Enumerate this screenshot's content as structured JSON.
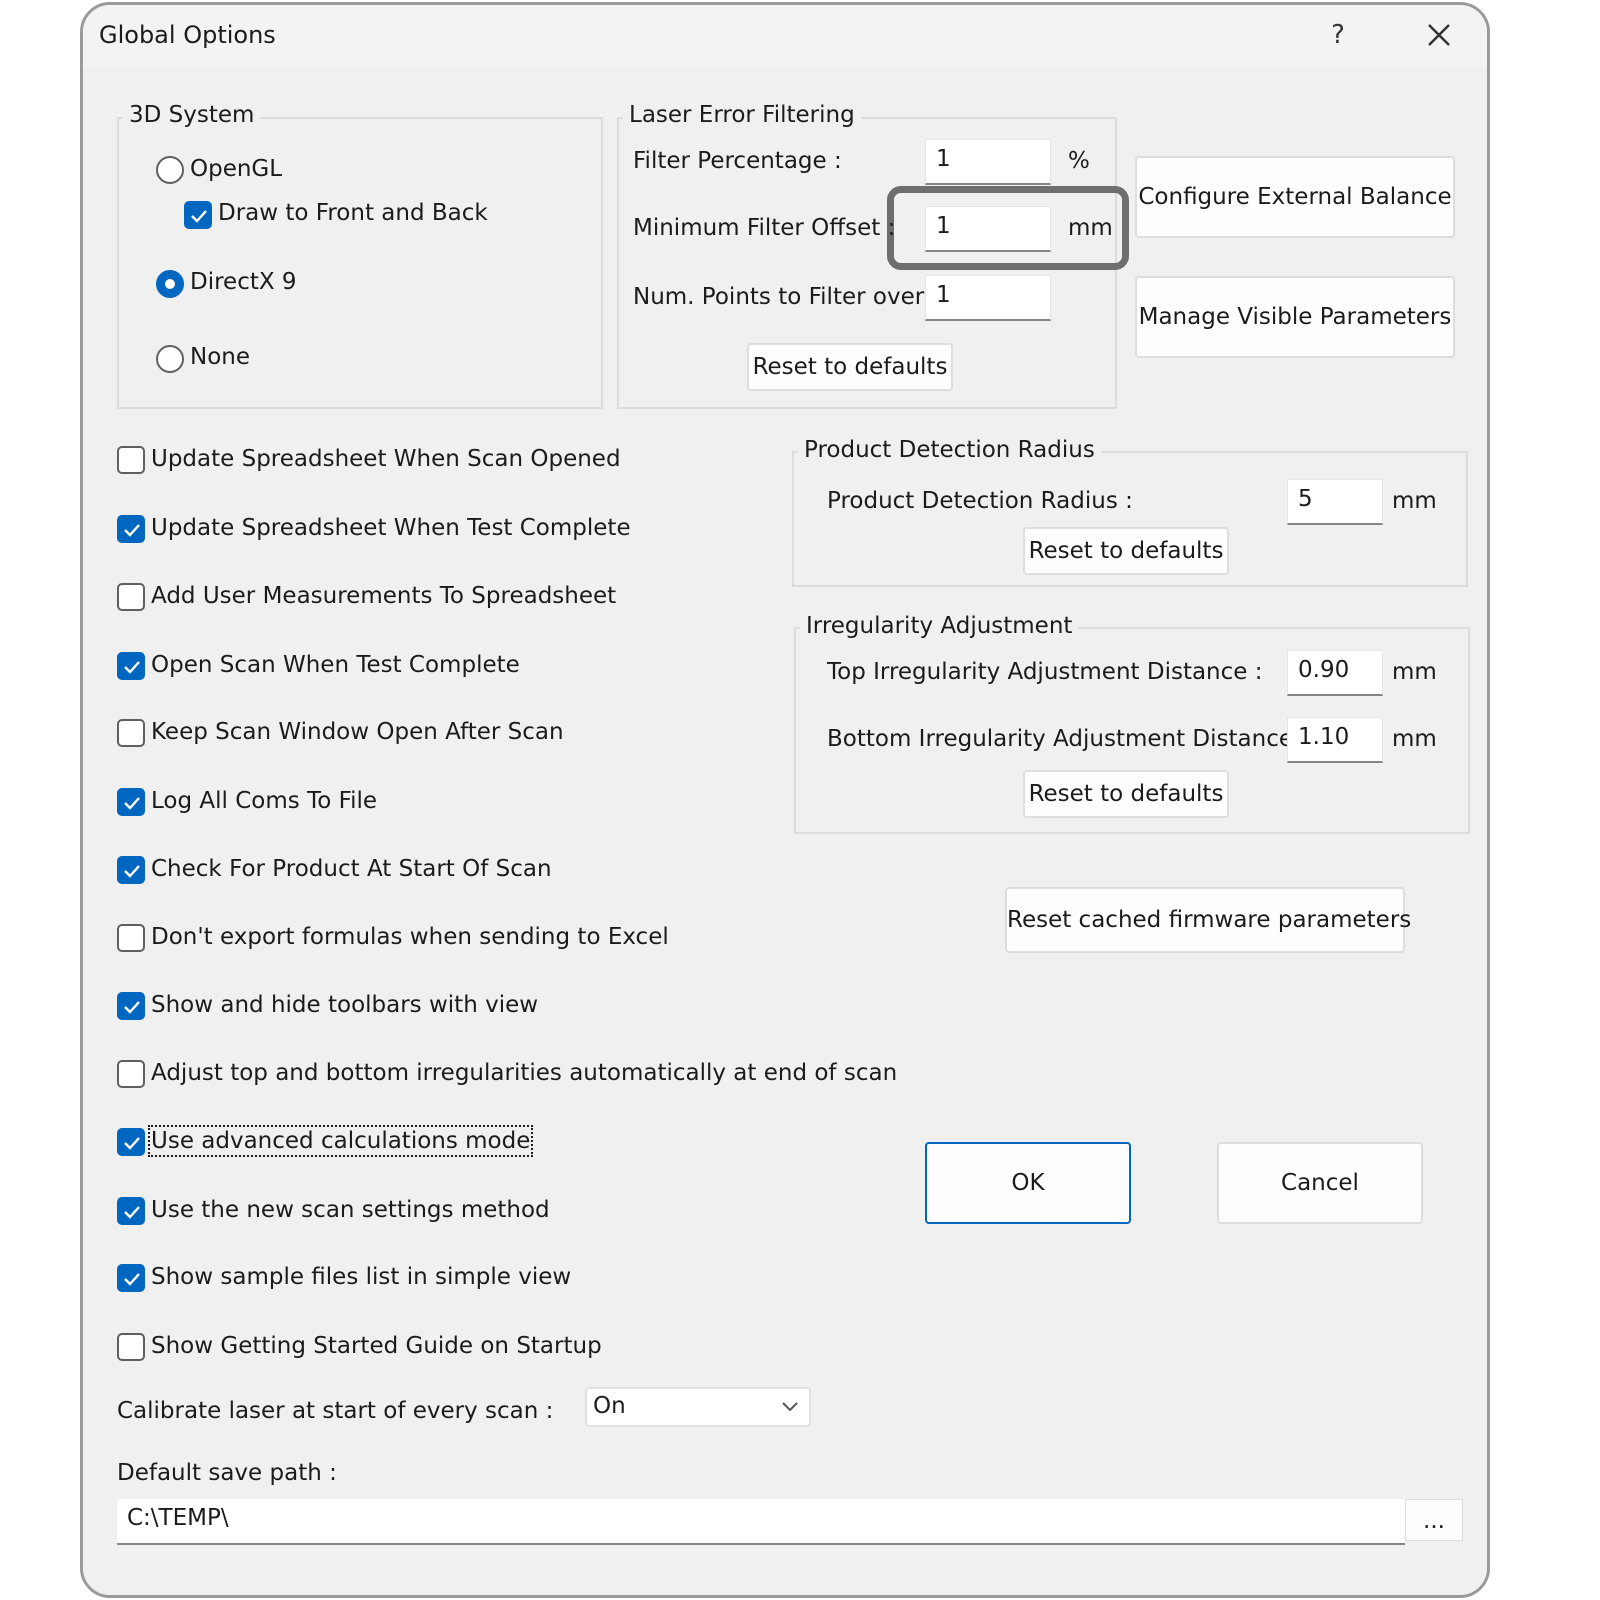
{
  "window": {
    "title": "Global Options",
    "help_label": "?"
  },
  "system3d": {
    "title": "3D System",
    "opengl_label": "OpenGL",
    "opengl_selected": false,
    "draw_front_back_label": "Draw to Front and Back",
    "draw_front_back_checked": true,
    "directx_label": "DirectX 9",
    "directx_selected": true,
    "none_label": "None",
    "none_selected": false
  },
  "laser": {
    "title": "Laser Error Filtering",
    "filter_pct_label": "Filter Percentage :",
    "filter_pct_value": "1",
    "filter_pct_unit": "%",
    "min_offset_label": "Minimum Filter Offset :",
    "min_offset_value": "1",
    "min_offset_unit": "mm",
    "num_points_label": "Num. Points to Filter over :",
    "num_points_value": "1",
    "reset_label": "Reset to defaults"
  },
  "side_buttons": {
    "configure_balance": "Configure External Balance",
    "manage_params": "Manage Visible Parameters"
  },
  "options": [
    {
      "label": "Update Spreadsheet When Scan Opened",
      "checked": false
    },
    {
      "label": "Update Spreadsheet When Test Complete",
      "checked": true
    },
    {
      "label": "Add User Measurements To Spreadsheet",
      "checked": false
    },
    {
      "label": "Open Scan When Test Complete",
      "checked": true
    },
    {
      "label": "Keep Scan Window Open After Scan",
      "checked": false
    },
    {
      "label": "Log All Coms To File",
      "checked": true
    },
    {
      "label": "Check For Product At Start Of Scan",
      "checked": true
    },
    {
      "label": "Don't export formulas when sending to Excel",
      "checked": false
    },
    {
      "label": "Show and hide toolbars with view",
      "checked": true
    },
    {
      "label": "Adjust top and bottom irregularities automatically at end of scan",
      "checked": false
    },
    {
      "label": "Use advanced calculations mode",
      "checked": true
    },
    {
      "label": "Use the new scan settings method",
      "checked": true
    },
    {
      "label": "Show sample files list in simple view",
      "checked": true
    },
    {
      "label": "Show Getting Started Guide on Startup",
      "checked": false
    }
  ],
  "product_detection": {
    "title": "Product Detection Radius",
    "radius_label": "Product Detection Radius :",
    "radius_value": "5",
    "radius_unit": "mm",
    "reset_label": "Reset to defaults"
  },
  "irregularity": {
    "title": "Irregularity Adjustment",
    "top_label": "Top Irregularity Adjustment Distance :",
    "top_value": "0.90",
    "top_unit": "mm",
    "bottom_label": "Bottom Irregularity Adjustment Distance :",
    "bottom_value": "1.10",
    "bottom_unit": "mm",
    "reset_label": "Reset to defaults"
  },
  "firmware_reset_label": "Reset cached firmware parameters",
  "ok_label": "OK",
  "cancel_label": "Cancel",
  "calibrate": {
    "label": "Calibrate laser at start of every scan :",
    "value": "On"
  },
  "save_path": {
    "label": "Default save path :",
    "value": "C:\\TEMP\\",
    "browse_label": "..."
  },
  "colors": {
    "accent": "#0067c0",
    "highlight_border": "#6e6e6e",
    "dialog_bg": "#f0f0f0"
  },
  "icons": [
    "close-icon",
    "checkmark-icon",
    "chevron-down-icon"
  ]
}
